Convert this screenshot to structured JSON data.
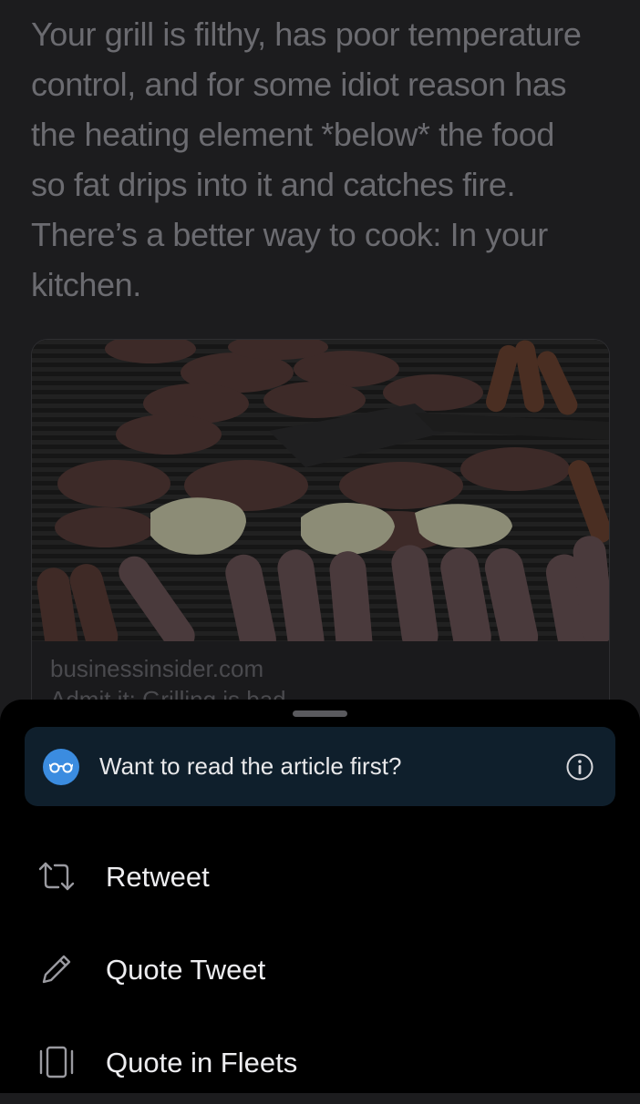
{
  "tweet": {
    "text": "Your grill is filthy, has poor temperature\ncontrol, and for some idiot reason has\nthe heating element *below* the food\nso fat drips into it and catches fire.\nThere’s a better way to cook: In your\nkitchen."
  },
  "card": {
    "domain": "businessinsider.com",
    "title": "Admit it: Grilling is bad"
  },
  "banner": {
    "text": "Want to read the article first?",
    "icon": "glasses-icon",
    "accent": "#3b8ce0"
  },
  "actions": [
    {
      "label": "Retweet",
      "icon": "retweet-icon"
    },
    {
      "label": "Quote Tweet",
      "icon": "pencil-icon"
    },
    {
      "label": "Quote in Fleets",
      "icon": "fleet-icon"
    }
  ],
  "colors": {
    "background": "#1c1c1e",
    "sheet": "#000000",
    "banner": "#0f1f2c"
  }
}
